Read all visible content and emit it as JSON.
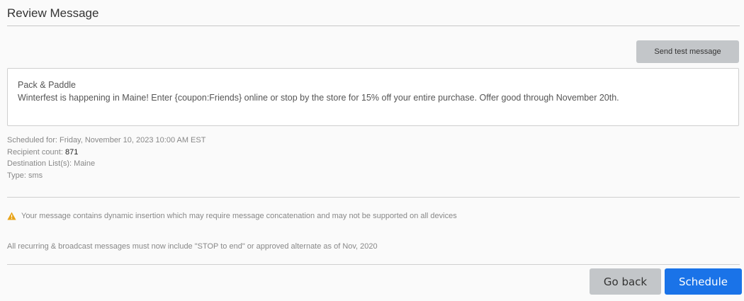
{
  "header": {
    "title": "Review Message"
  },
  "toolbar": {
    "send_test_label": "Send test message"
  },
  "message": {
    "sender": "Pack & Paddle",
    "body": "Winterfest is happening in Maine! Enter {coupon:Friends} online or stop by the store for 15% off your entire purchase. Offer good through November 20th."
  },
  "details": {
    "scheduled_label": "Scheduled for:",
    "scheduled_value": "Friday, November 10, 2023 10:00 AM EST",
    "recipient_label": "Recipient count:",
    "recipient_value": "871",
    "destination_label": "Destination List(s):",
    "destination_value": "Maine",
    "type_label": "Type:",
    "type_value": "sms"
  },
  "warning": {
    "icon": "warning-triangle-icon",
    "text": "Your message contains dynamic insertion which may require message concatenation and may not be supported on all devices"
  },
  "notice": {
    "text": "All recurring & broadcast messages must now include \"STOP to end\" or approved alternate as of Nov, 2020"
  },
  "actions": {
    "back_label": "Go back",
    "schedule_label": "Schedule"
  },
  "colors": {
    "primary": "#1a73e8",
    "secondary": "#c3c6c9",
    "warning": "#e8a317"
  }
}
